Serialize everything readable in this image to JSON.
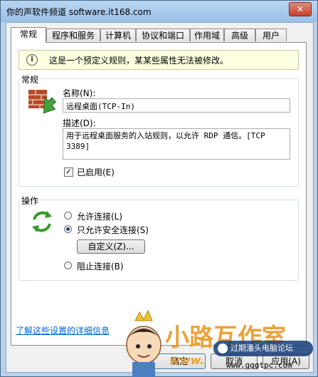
{
  "window": {
    "title": "你的声软件频道 software.it168.com"
  },
  "tabs": [
    {
      "label": "常规"
    },
    {
      "label": "程序和服务"
    },
    {
      "label": "计算机"
    },
    {
      "label": "协议和端口"
    },
    {
      "label": "作用域"
    },
    {
      "label": "高级"
    },
    {
      "label": "用户"
    }
  ],
  "info_bar": {
    "text": "这是一个预定义规则，某某些属性无法被修改。"
  },
  "general": {
    "group_label": "常规",
    "name_label": "名称(N):",
    "name_value": "远程桌面(TCP-In)",
    "desc_label": "描述(D):",
    "desc_value": "用于远程桌面服务的入站规则，以允许 RDP 通信。[TCP 3389]",
    "enabled_label": "已启用(E)",
    "enabled": true
  },
  "action": {
    "group_label": "操作",
    "allow_label": "允许连接(L)",
    "allow_secure_label": "只允许安全连接(S)",
    "customize_label": "自定义(Z)...",
    "block_label": "阻止连接(B)",
    "selected": "allow_secure"
  },
  "footer": {
    "learn_more": "了解这些设置的详细信息",
    "ok_label": "确定",
    "cancel_label": "取消",
    "apply_label": "应用(A)"
  },
  "watermark": {
    "text_main": "小路互作室",
    "text_www": "www.",
    "text_url": "www.gqgtpc.com",
    "badge": "过期潘头电脑论坛"
  }
}
